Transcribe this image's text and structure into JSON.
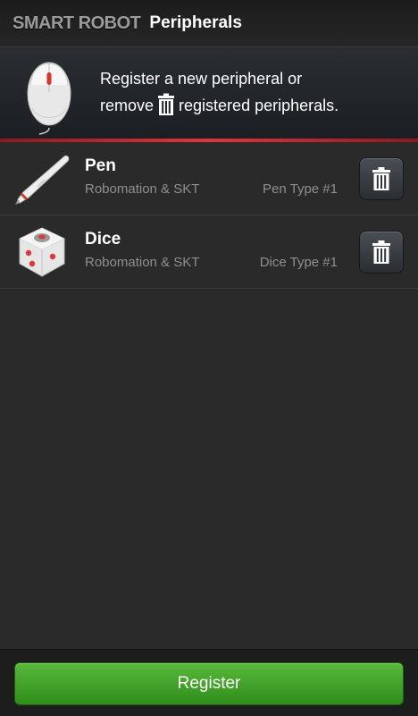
{
  "header": {
    "brand": "SMART ROBOT",
    "title": "Peripherals"
  },
  "banner": {
    "line1": "Register a new peripheral or",
    "line2_before": "remove",
    "line2_after": "registered peripherals.",
    "icon": "mouse-icon",
    "inline_icon": "trash-icon"
  },
  "peripherals": [
    {
      "name": "Pen",
      "maker": "Robomation & SKT",
      "type": "Pen Type #1",
      "icon": "pen-icon"
    },
    {
      "name": "Dice",
      "maker": "Robomation & SKT",
      "type": "Dice Type #1",
      "icon": "dice-icon"
    }
  ],
  "footer": {
    "register_label": "Register"
  },
  "colors": {
    "accent_red": "#e0353d",
    "button_green": "#3fa526",
    "background": "#2a2a2a"
  }
}
